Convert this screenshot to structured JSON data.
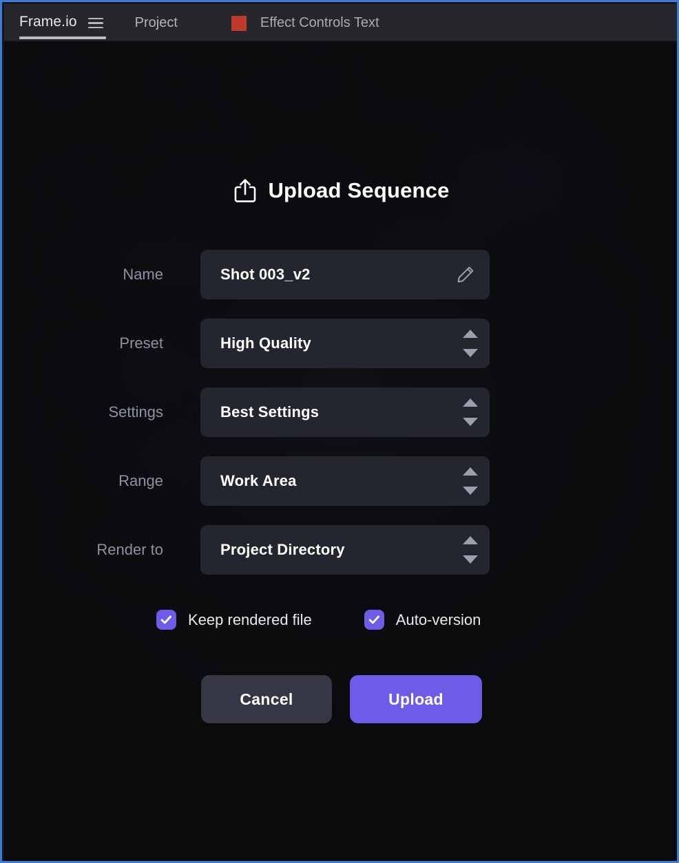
{
  "menubar": {
    "brand": "Frame.io",
    "hamburger_icon": "hamburger-menu-icon",
    "project_item": "Project",
    "chip_color": "#c0392f",
    "context_label": "Effect Controls Text"
  },
  "dialog": {
    "icon": "upload-share-icon",
    "title": "Upload Sequence",
    "fields": [
      {
        "label": "Name",
        "value": "Shot 003_v2",
        "control": "text",
        "trailing_icon": "pencil-edit-icon"
      },
      {
        "label": "Preset",
        "value": "High Quality",
        "control": "stepper",
        "trailing_icon": "stepper-arrows-icon"
      },
      {
        "label": "Settings",
        "value": "Best Settings",
        "control": "stepper",
        "trailing_icon": "stepper-arrows-icon"
      },
      {
        "label": "Range",
        "value": "Work Area",
        "control": "stepper",
        "trailing_icon": "stepper-arrows-icon"
      },
      {
        "label": "Render to",
        "value": "Project Directory",
        "control": "stepper",
        "trailing_icon": "stepper-arrows-icon"
      }
    ],
    "checkboxes": [
      {
        "label": "Keep rendered file",
        "checked": true
      },
      {
        "label": "Auto-version",
        "checked": true
      }
    ],
    "buttons": {
      "cancel": "Cancel",
      "upload": "Upload"
    }
  },
  "colors": {
    "accent": "#6c5ce7",
    "window_focus_border": "#3b7dd8",
    "field_background": "#23262f",
    "cancel_background": "#353844",
    "label_text": "#8e93a3",
    "menubar_background": "#26272a"
  }
}
